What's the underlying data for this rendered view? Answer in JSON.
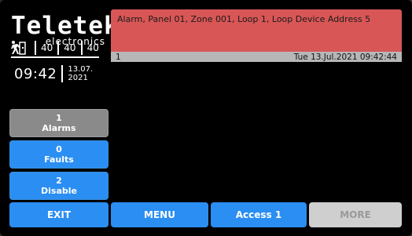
{
  "brand": {
    "logo": "Teletek",
    "sub": "electronics"
  },
  "counters": {
    "a": "40",
    "b": "40",
    "c": "40"
  },
  "clock": {
    "time": "09:42",
    "date_day": "13.07.",
    "date_year": "2021"
  },
  "side_buttons": {
    "alarms": {
      "count": "1",
      "label": "Alarms"
    },
    "faults": {
      "count": "0",
      "label": "Faults"
    },
    "disable": {
      "count": "2",
      "label": "Disable"
    }
  },
  "alarm": {
    "message": "Alarm, Panel 01, Zone 001, Loop 1, Loop Device Address 5",
    "index": "1",
    "timestamp": "Tue 13.Jul.2021 09:42:44"
  },
  "bottom": {
    "exit": "EXIT",
    "menu": "MENU",
    "access": "Access 1",
    "more": "MORE"
  },
  "colors": {
    "alarm_bg": "#d85656",
    "button_blue": "#2b8ef2",
    "button_grey": "#8a8a8a",
    "button_disabled": "#cfcfcf"
  }
}
